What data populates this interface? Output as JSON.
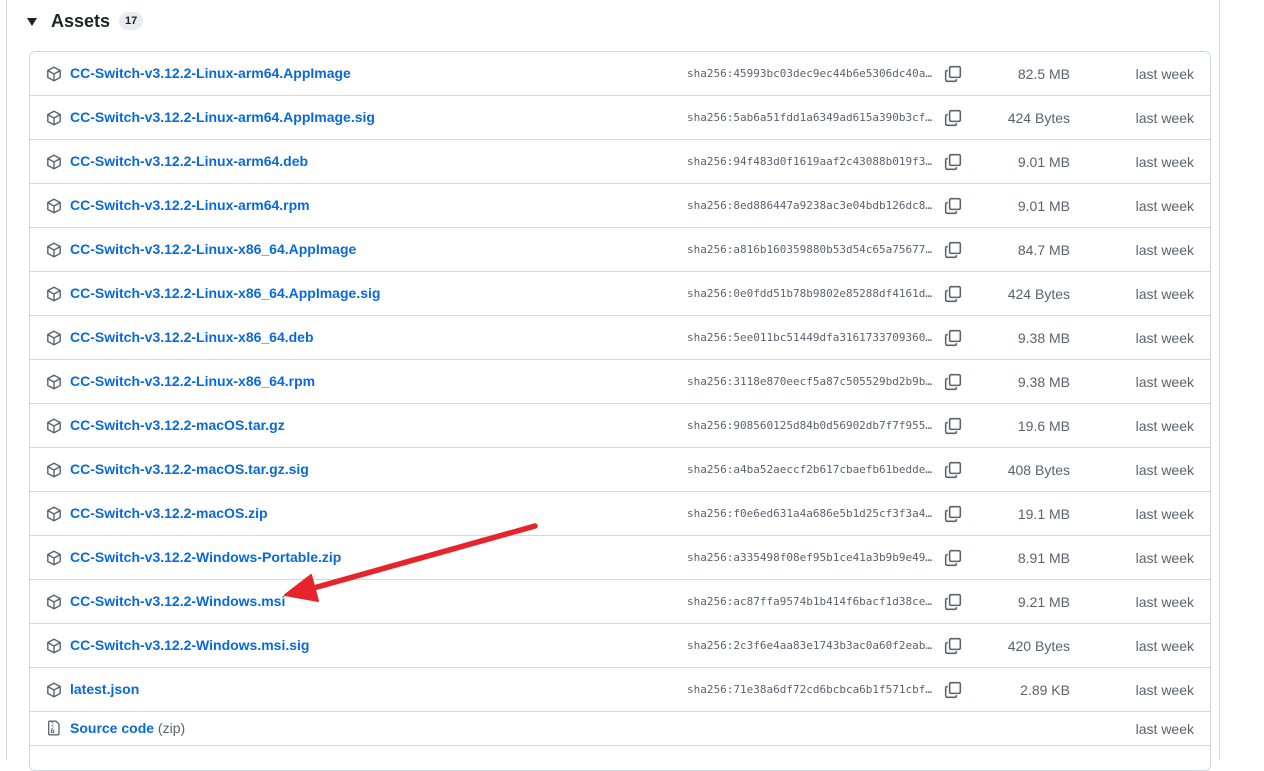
{
  "assets": {
    "title": "Assets",
    "count": "17",
    "rows": [
      {
        "name": "CC-Switch-v3.12.2-Linux-arm64.AppImage",
        "sha": "sha256:45993bc03dec9ec44b6e5306dc40a…",
        "size": "82.5 MB",
        "time": "last week"
      },
      {
        "name": "CC-Switch-v3.12.2-Linux-arm64.AppImage.sig",
        "sha": "sha256:5ab6a51fdd1a6349ad615a390b3cf…",
        "size": "424 Bytes",
        "time": "last week"
      },
      {
        "name": "CC-Switch-v3.12.2-Linux-arm64.deb",
        "sha": "sha256:94f483d0f1619aaf2c43088b019f3…",
        "size": "9.01 MB",
        "time": "last week"
      },
      {
        "name": "CC-Switch-v3.12.2-Linux-arm64.rpm",
        "sha": "sha256:8ed886447a9238ac3e04bdb126dc8…",
        "size": "9.01 MB",
        "time": "last week"
      },
      {
        "name": "CC-Switch-v3.12.2-Linux-x86_64.AppImage",
        "sha": "sha256:a816b160359880b53d54c65a75677…",
        "size": "84.7 MB",
        "time": "last week"
      },
      {
        "name": "CC-Switch-v3.12.2-Linux-x86_64.AppImage.sig",
        "sha": "sha256:0e0fdd51b78b9802e85288df4161d…",
        "size": "424 Bytes",
        "time": "last week"
      },
      {
        "name": "CC-Switch-v3.12.2-Linux-x86_64.deb",
        "sha": "sha256:5ee011bc51449dfa3161733709360…",
        "size": "9.38 MB",
        "time": "last week"
      },
      {
        "name": "CC-Switch-v3.12.2-Linux-x86_64.rpm",
        "sha": "sha256:3118e870eecf5a87c505529bd2b9b…",
        "size": "9.38 MB",
        "time": "last week"
      },
      {
        "name": "CC-Switch-v3.12.2-macOS.tar.gz",
        "sha": "sha256:908560125d84b0d56902db7f7f955…",
        "size": "19.6 MB",
        "time": "last week"
      },
      {
        "name": "CC-Switch-v3.12.2-macOS.tar.gz.sig",
        "sha": "sha256:a4ba52aeccf2b617cbaefb61bedde…",
        "size": "408 Bytes",
        "time": "last week"
      },
      {
        "name": "CC-Switch-v3.12.2-macOS.zip",
        "sha": "sha256:f0e6ed631a4a686e5b1d25cf3f3a4…",
        "size": "19.1 MB",
        "time": "last week"
      },
      {
        "name": "CC-Switch-v3.12.2-Windows-Portable.zip",
        "sha": "sha256:a335498f08ef95b1ce41a3b9b9e49…",
        "size": "8.91 MB",
        "time": "last week"
      },
      {
        "name": "CC-Switch-v3.12.2-Windows.msi",
        "sha": "sha256:ac87ffa9574b1b414f6bacf1d38ce…",
        "size": "9.21 MB",
        "time": "last week"
      },
      {
        "name": "CC-Switch-v3.12.2-Windows.msi.sig",
        "sha": "sha256:2c3f6e4aa83e1743b3ac0a60f2eab…",
        "size": "420 Bytes",
        "time": "last week"
      },
      {
        "name": "latest.json",
        "sha": "sha256:71e38a6df72cd6bcbca6b1f571cbf…",
        "size": "2.89 KB",
        "time": "last week"
      }
    ],
    "source": {
      "label": "Source code",
      "suffix": "(zip)",
      "time": "last week"
    }
  },
  "icons": {
    "row_icon": "package-icon",
    "copy_icon": "copy-icon",
    "source_icon": "file-zip-icon",
    "toggle_icon": "triangle-down-icon",
    "annotation": "red-arrow-annotation"
  },
  "colors": {
    "link": "#0969da",
    "muted": "#59636e",
    "border": "#d1d9e0",
    "arrow": "#e5242b"
  }
}
